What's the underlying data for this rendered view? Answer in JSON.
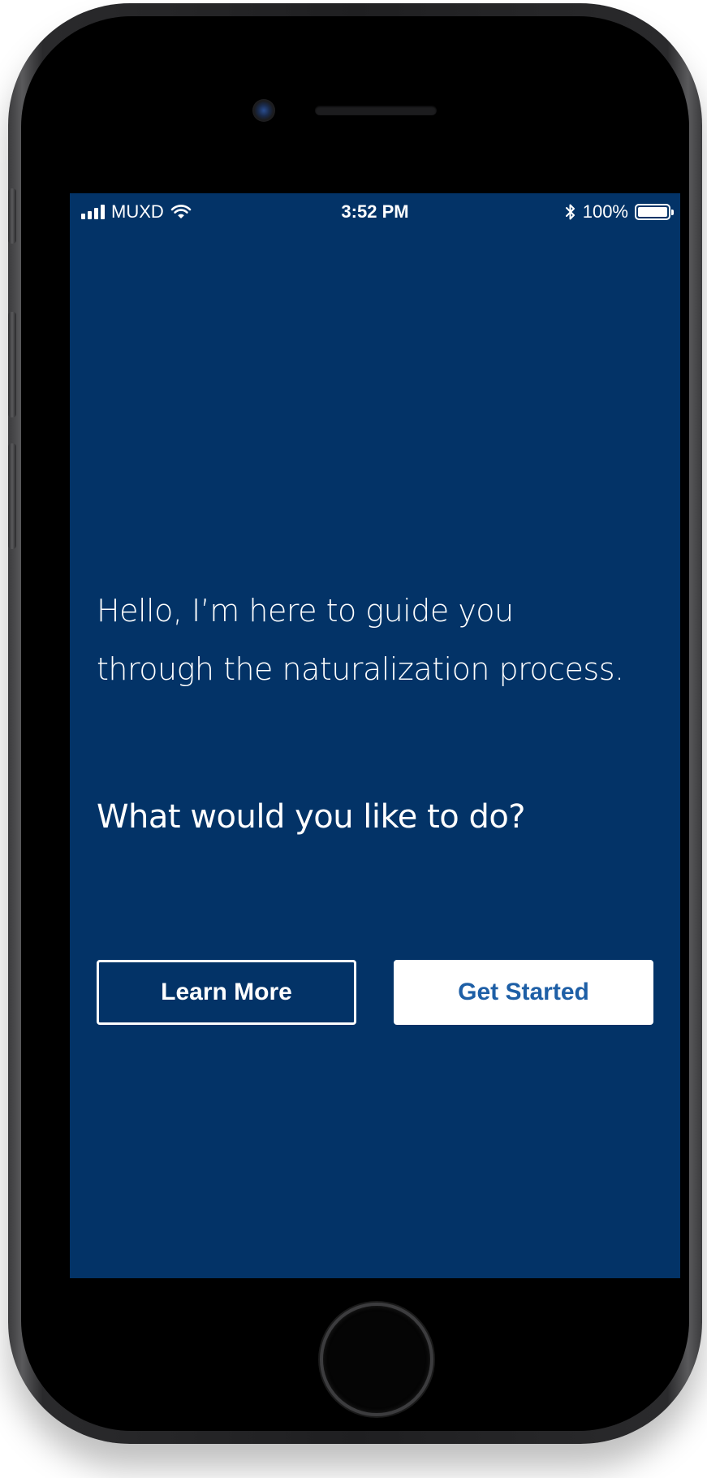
{
  "status_bar": {
    "carrier": "MUXD",
    "time": "3:52 PM",
    "battery_percent_text": "100%",
    "battery_level": 1.0
  },
  "main": {
    "intro_line_1": "Hello, I’m here to guide you",
    "intro_line_2": "through the naturalization process.",
    "question": "What would you like to do?",
    "learn_more_label": "Learn More",
    "get_started_label": "Get Started"
  },
  "colors": {
    "screen_background": "#033367",
    "text": "#ffffff",
    "primary_button_text": "#1e5fa6"
  },
  "icons": [
    "signal-icon",
    "wifi-icon",
    "bluetooth-icon",
    "battery-icon"
  ]
}
